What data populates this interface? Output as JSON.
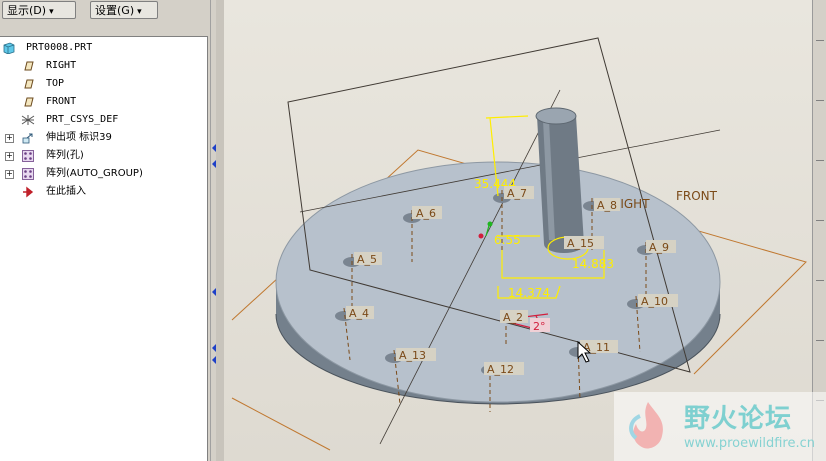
{
  "menu": {
    "display": "显示(D)",
    "settings": "设置(G)"
  },
  "tree": {
    "root": "PRT0008.PRT",
    "items": [
      {
        "label": "RIGHT",
        "icon": "datum-plane-icon",
        "expandable": false
      },
      {
        "label": "TOP",
        "icon": "datum-plane-icon",
        "expandable": false
      },
      {
        "label": "FRONT",
        "icon": "datum-plane-icon",
        "expandable": false
      },
      {
        "label": "PRT_CSYS_DEF",
        "icon": "csys-icon",
        "expandable": false
      },
      {
        "label": "伸出项 标识39",
        "icon": "extrude-icon",
        "expandable": true
      },
      {
        "label": "阵列(孔)",
        "icon": "pattern-icon",
        "expandable": true
      },
      {
        "label": "阵列(AUTO_GROUP)",
        "icon": "pattern-icon",
        "expandable": true
      },
      {
        "label": "在此插入",
        "icon": "insert-here-icon",
        "expandable": false
      }
    ]
  },
  "model": {
    "plane_labels": [
      "RIGHT",
      "FRONT"
    ],
    "axes": [
      "A_6",
      "A_7",
      "A_8",
      "A_5",
      "A_15",
      "A_9",
      "A_4",
      "A_10",
      "A_2",
      "A_13",
      "A_12",
      "A_11"
    ],
    "dimensions": [
      "35.444",
      "6.55",
      "14.883",
      "14.374"
    ],
    "angle_dim": "2°",
    "colors": {
      "body": "#b7c1cc",
      "dim": "#ffee00",
      "plane": "#403a34",
      "orange_plane": "#c07830",
      "selected": "#d21e3c"
    }
  },
  "watermark": {
    "title": "野火论坛",
    "url": "www.proewildfire.cn"
  }
}
